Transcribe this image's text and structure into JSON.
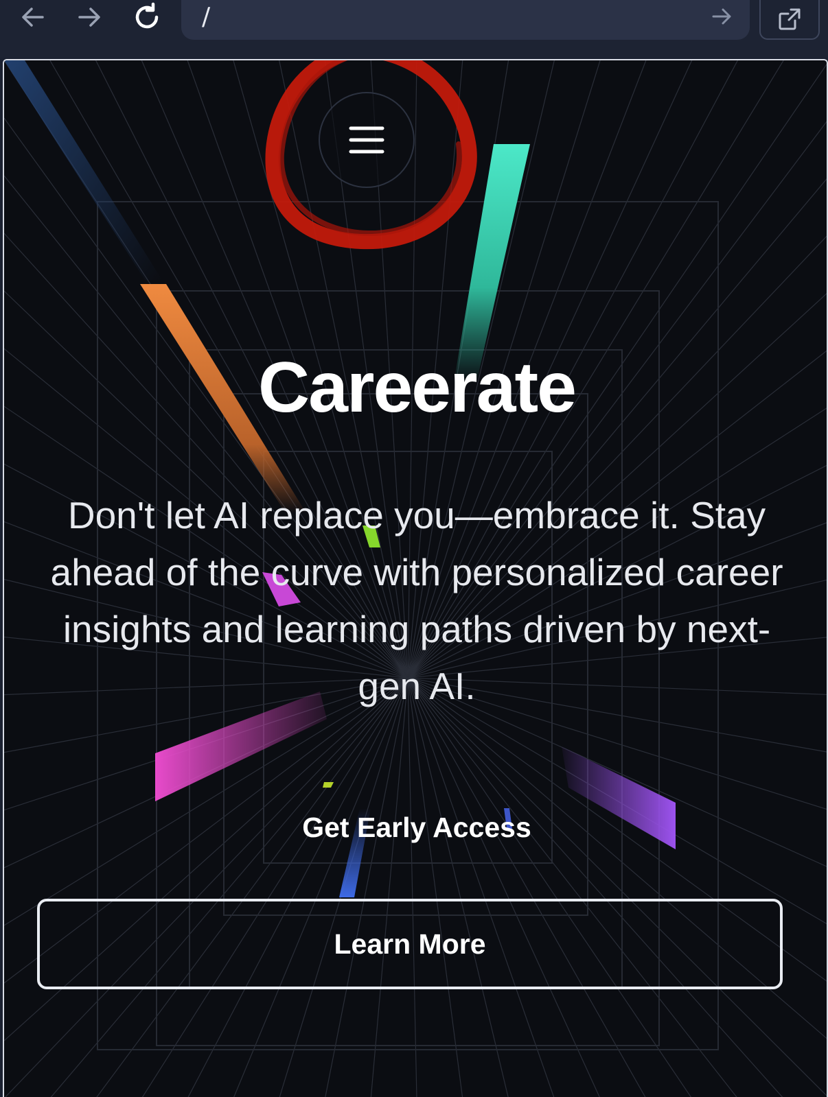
{
  "browser": {
    "url": "/",
    "icons": {
      "back": "back-arrow-icon",
      "forward": "forward-arrow-icon",
      "reload": "reload-icon",
      "go": "go-arrow-icon",
      "share": "open-external-icon"
    }
  },
  "page": {
    "menu_icon": "hamburger-menu-icon",
    "title": "Careerate",
    "subtitle": "Don't let AI replace you—embrace it. Stay ahead of the curve with personalized career insights and learning paths driven by next-gen AI.",
    "primary_cta": "Get Early Access",
    "secondary_cta": "Learn More"
  },
  "colors": {
    "background": "#0b0d12",
    "toolbar": "#1d2333",
    "accent_teal": "#44e6c4",
    "accent_orange": "#e8823c",
    "accent_pink": "#e64bc9",
    "accent_purple": "#9b4fe8",
    "accent_blue": "#3d68e0",
    "annotation_red": "#c21a0c"
  }
}
